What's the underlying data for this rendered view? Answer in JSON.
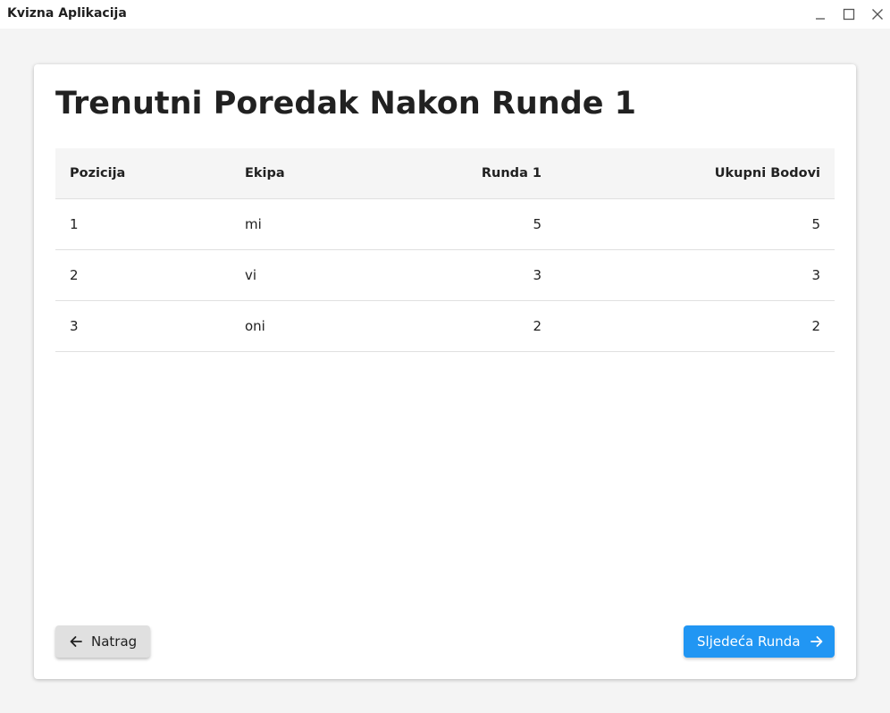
{
  "window": {
    "title": "Kvizna Aplikacija",
    "controls": [
      "minimize-icon",
      "maximize-icon",
      "close-icon"
    ]
  },
  "main": {
    "heading": "Trenutni Poredak Nakon Runde 1",
    "table": {
      "headers": {
        "position": "Pozicija",
        "team": "Ekipa",
        "round1": "Runda 1",
        "total": "Ukupni Bodovi"
      },
      "rows": [
        {
          "position": "1",
          "team": "mi",
          "round1": "5",
          "total": "5"
        },
        {
          "position": "2",
          "team": "vi",
          "round1": "3",
          "total": "3"
        },
        {
          "position": "3",
          "team": "oni",
          "round1": "2",
          "total": "2"
        }
      ]
    }
  },
  "actions": {
    "back_label": "Natrag",
    "back_icon": "arrow-left-icon",
    "next_label": "Sljedeća Runda",
    "next_icon": "arrow-right-icon",
    "accent": "#2196f3"
  }
}
